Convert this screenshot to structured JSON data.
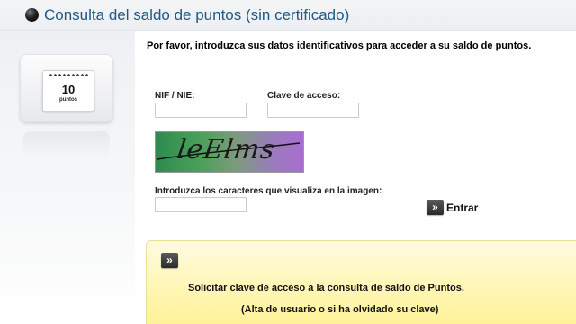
{
  "header": {
    "title": "Consulta del saldo de puntos (sin certificado)"
  },
  "points_card": {
    "number": "10",
    "unit": "puntos"
  },
  "form": {
    "intro": "Por favor, introduzca sus datos identificativos para acceder a su saldo de puntos.",
    "nif_label": "NIF / NIE:",
    "nif_value": "",
    "password_label": "Clave de acceso:",
    "password_value": "",
    "captcha_text": "leElms",
    "captcha_label": "Introduzca los caracteres que visualiza en la imagen:",
    "captcha_value": "",
    "enter_label": "Entrar",
    "arrow_glyph": "»"
  },
  "request_box": {
    "arrow_glyph": "»",
    "line1": "Solicitar clave de acceso a la consulta de saldo de Puntos.",
    "line2": "(Alta de usuario o si ha olvidado su clave)"
  },
  "colors": {
    "title": "#1e5a86",
    "request_box_bg": "#fff6b6"
  }
}
